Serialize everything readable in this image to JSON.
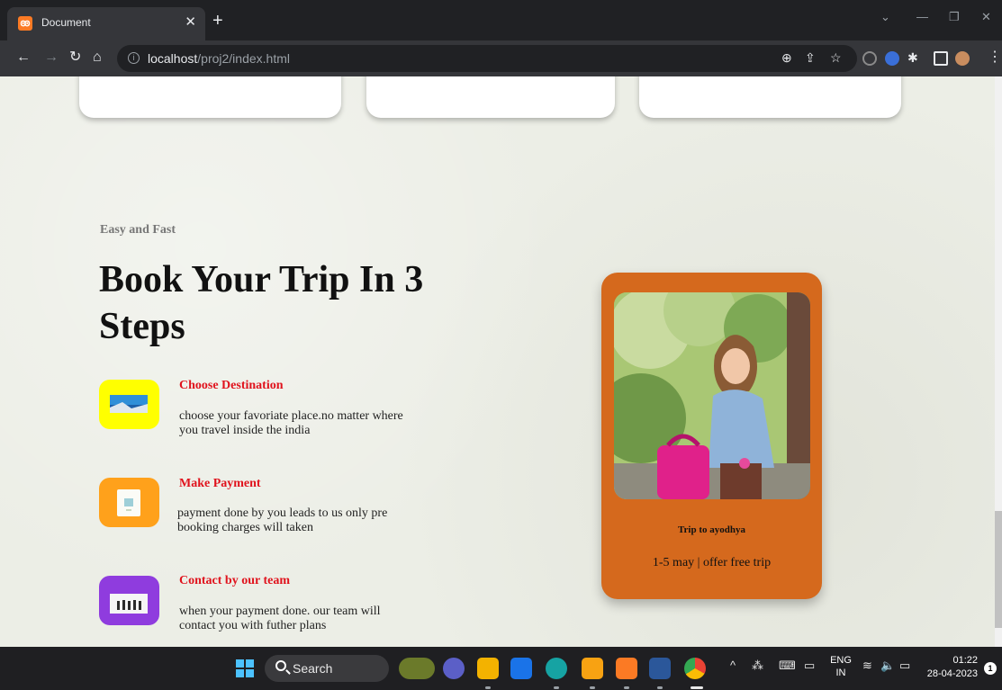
{
  "browser": {
    "tab_title": "Document",
    "tab_favicon": "xampp-icon",
    "url_host": "localhost",
    "url_path": "/proj2/index.html"
  },
  "page": {
    "eyebrow": "Easy and Fast",
    "headline": "Book Your Trip In 3 Steps",
    "steps": [
      {
        "title": "Choose Destination",
        "text": "choose your favoriate place.no matter where you travel inside the india",
        "icon_color": "#ffff00"
      },
      {
        "title": "Make Payment",
        "text": "payment done by you leads to us only pre booking charges will taken",
        "icon_color": "#ffa11b"
      },
      {
        "title": "Contact by our team",
        "text": "when your payment done. our team will contact you with futher plans",
        "icon_color": "#8f3cde"
      }
    ],
    "trip_card": {
      "title": "Trip to ayodhya",
      "text": "1-5 may | offer free trip",
      "color": "#d5691d"
    },
    "accent_color": "#e0131d"
  },
  "taskbar": {
    "search_label": "Search",
    "lang_top": "ENG",
    "lang_bottom": "IN",
    "time": "01:22",
    "date": "28-04-2023",
    "notification_count": "1"
  }
}
